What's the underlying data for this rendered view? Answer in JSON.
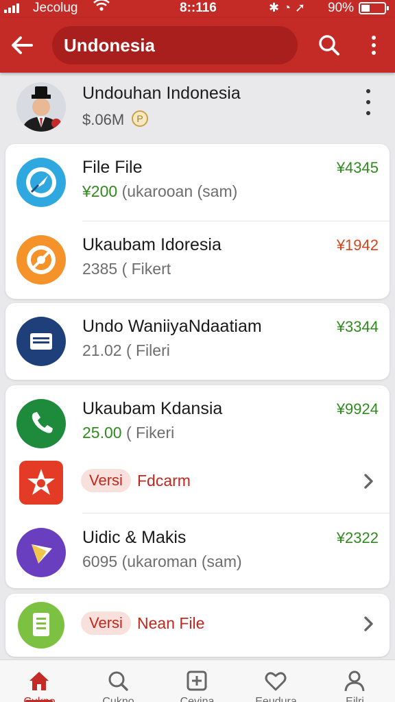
{
  "status_bar": {
    "carrier": "Jecolug",
    "time": "8::116",
    "battery": "90%",
    "icons": [
      "signal-icon",
      "wifi-icon",
      "bluetooth-icon",
      "alarm-icon",
      "location-icon",
      "battery-icon"
    ]
  },
  "header": {
    "title": "Undonesia",
    "icons": [
      "back-arrow-icon",
      "search-icon",
      "more-vertical-icon"
    ]
  },
  "profile": {
    "name": "Undouhan Indonesia",
    "balance": "$.06M",
    "coin_symbol": "P"
  },
  "items": [
    {
      "title": "File File",
      "sub_main": "¥200",
      "sub_rest": "(ukarooan (sam)",
      "amount": "¥4345",
      "amount_color": "#2f8a1e",
      "icon": "compass-icon",
      "icon_color": "#2fa8e0"
    },
    {
      "title": "Ukaubam Idoresia",
      "sub_main": "2385",
      "sub_rest": "( Fikert",
      "amount": "¥1942",
      "amount_color": "#d1461c",
      "icon": "orange-disc-icon",
      "icon_color": "#f5922a"
    },
    {
      "title": "Undo WaniiyaNdaatiam",
      "sub_main": "21.02",
      "sub_rest": "( Fileri",
      "amount": "¥3344",
      "amount_color": "#2f8a1e",
      "icon": "document-icon",
      "icon_color": "#1f3f7a"
    },
    {
      "title": "Ukaubam Kdansia",
      "sub_main": "25.00",
      "sub_rest": "( Fikeri",
      "amount": "¥9924",
      "amount_color": "#2f8a1e",
      "icon": "phone-icon",
      "icon_color": "#1e8a3c"
    },
    {
      "title": "Uidic & Makis",
      "sub_main": "6095",
      "sub_rest": "(ukaroman (sam)",
      "amount": "¥2322",
      "amount_color": "#2f8a1e",
      "icon": "triangle-icon",
      "icon_color": "#6a3fbf"
    }
  ],
  "version_rows": [
    {
      "badge": "Versi",
      "label": "Fdcarm",
      "icon": "star-icon",
      "icon_color": "#e33b26"
    },
    {
      "badge": "Versi",
      "label": "Nean File",
      "icon": "file-icon",
      "icon_color": "#7cc142"
    }
  ],
  "bottom_nav": [
    {
      "label": "Cukno",
      "icon": "home-icon",
      "active": true
    },
    {
      "label": "Cukno",
      "icon": "search-icon",
      "active": false
    },
    {
      "label": "Cevina",
      "icon": "plus-square-icon",
      "active": false
    },
    {
      "label": "Eeudura",
      "icon": "heart-icon",
      "active": false
    },
    {
      "label": "Eilri",
      "icon": "user-icon",
      "active": false
    }
  ],
  "colors": {
    "accent": "#c42a26",
    "accent_dark": "#a91f1d",
    "positive": "#2f8a1e",
    "warning": "#d1461c",
    "background": "#e9e9eb"
  }
}
